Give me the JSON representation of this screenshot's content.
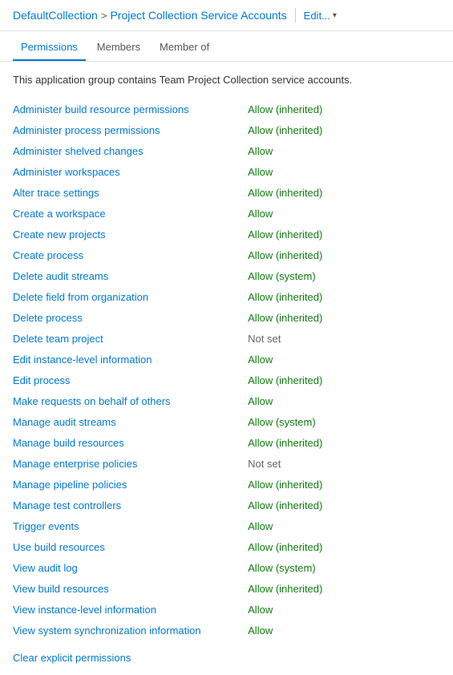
{
  "header": {
    "collection": "DefaultCollection",
    "separator": ">",
    "page": "Project Collection Service Accounts",
    "edit_label": "Edit...",
    "dropdown_arrow": "▾"
  },
  "tabs": [
    {
      "label": "Permissions",
      "active": true
    },
    {
      "label": "Members",
      "active": false
    },
    {
      "label": "Member of",
      "active": false
    }
  ],
  "description": "This application group contains Team Project Collection service accounts.",
  "permissions": [
    {
      "name": "Administer build resource permissions",
      "value": "Allow (inherited)",
      "type": "allow-inherited"
    },
    {
      "name": "Administer process permissions",
      "value": "Allow (inherited)",
      "type": "allow-inherited"
    },
    {
      "name": "Administer shelved changes",
      "value": "Allow",
      "type": "allow"
    },
    {
      "name": "Administer workspaces",
      "value": "Allow",
      "type": "allow"
    },
    {
      "name": "Alter trace settings",
      "value": "Allow (inherited)",
      "type": "allow-inherited"
    },
    {
      "name": "Create a workspace",
      "value": "Allow",
      "type": "allow"
    },
    {
      "name": "Create new projects",
      "value": "Allow (inherited)",
      "type": "allow-inherited"
    },
    {
      "name": "Create process",
      "value": "Allow (inherited)",
      "type": "allow-inherited"
    },
    {
      "name": "Delete audit streams",
      "value": "Allow (system)",
      "type": "allow-system"
    },
    {
      "name": "Delete field from organization",
      "value": "Allow (inherited)",
      "type": "allow-inherited"
    },
    {
      "name": "Delete process",
      "value": "Allow (inherited)",
      "type": "allow-inherited"
    },
    {
      "name": "Delete team project",
      "value": "Not set",
      "type": "not-set"
    },
    {
      "name": "Edit instance-level information",
      "value": "Allow",
      "type": "allow"
    },
    {
      "name": "Edit process",
      "value": "Allow (inherited)",
      "type": "allow-inherited"
    },
    {
      "name": "Make requests on behalf of others",
      "value": "Allow",
      "type": "allow"
    },
    {
      "name": "Manage audit streams",
      "value": "Allow (system)",
      "type": "allow-system"
    },
    {
      "name": "Manage build resources",
      "value": "Allow (inherited)",
      "type": "allow-inherited"
    },
    {
      "name": "Manage enterprise policies",
      "value": "Not set",
      "type": "not-set"
    },
    {
      "name": "Manage pipeline policies",
      "value": "Allow (inherited)",
      "type": "allow-inherited"
    },
    {
      "name": "Manage test controllers",
      "value": "Allow (inherited)",
      "type": "allow-inherited"
    },
    {
      "name": "Trigger events",
      "value": "Allow",
      "type": "allow"
    },
    {
      "name": "Use build resources",
      "value": "Allow (inherited)",
      "type": "allow-inherited"
    },
    {
      "name": "View audit log",
      "value": "Allow (system)",
      "type": "allow-system"
    },
    {
      "name": "View build resources",
      "value": "Allow (inherited)",
      "type": "allow-inherited"
    },
    {
      "name": "View instance-level information",
      "value": "Allow",
      "type": "allow"
    },
    {
      "name": "View system synchronization information",
      "value": "Allow",
      "type": "allow"
    }
  ],
  "clear_label": "Clear explicit permissions"
}
